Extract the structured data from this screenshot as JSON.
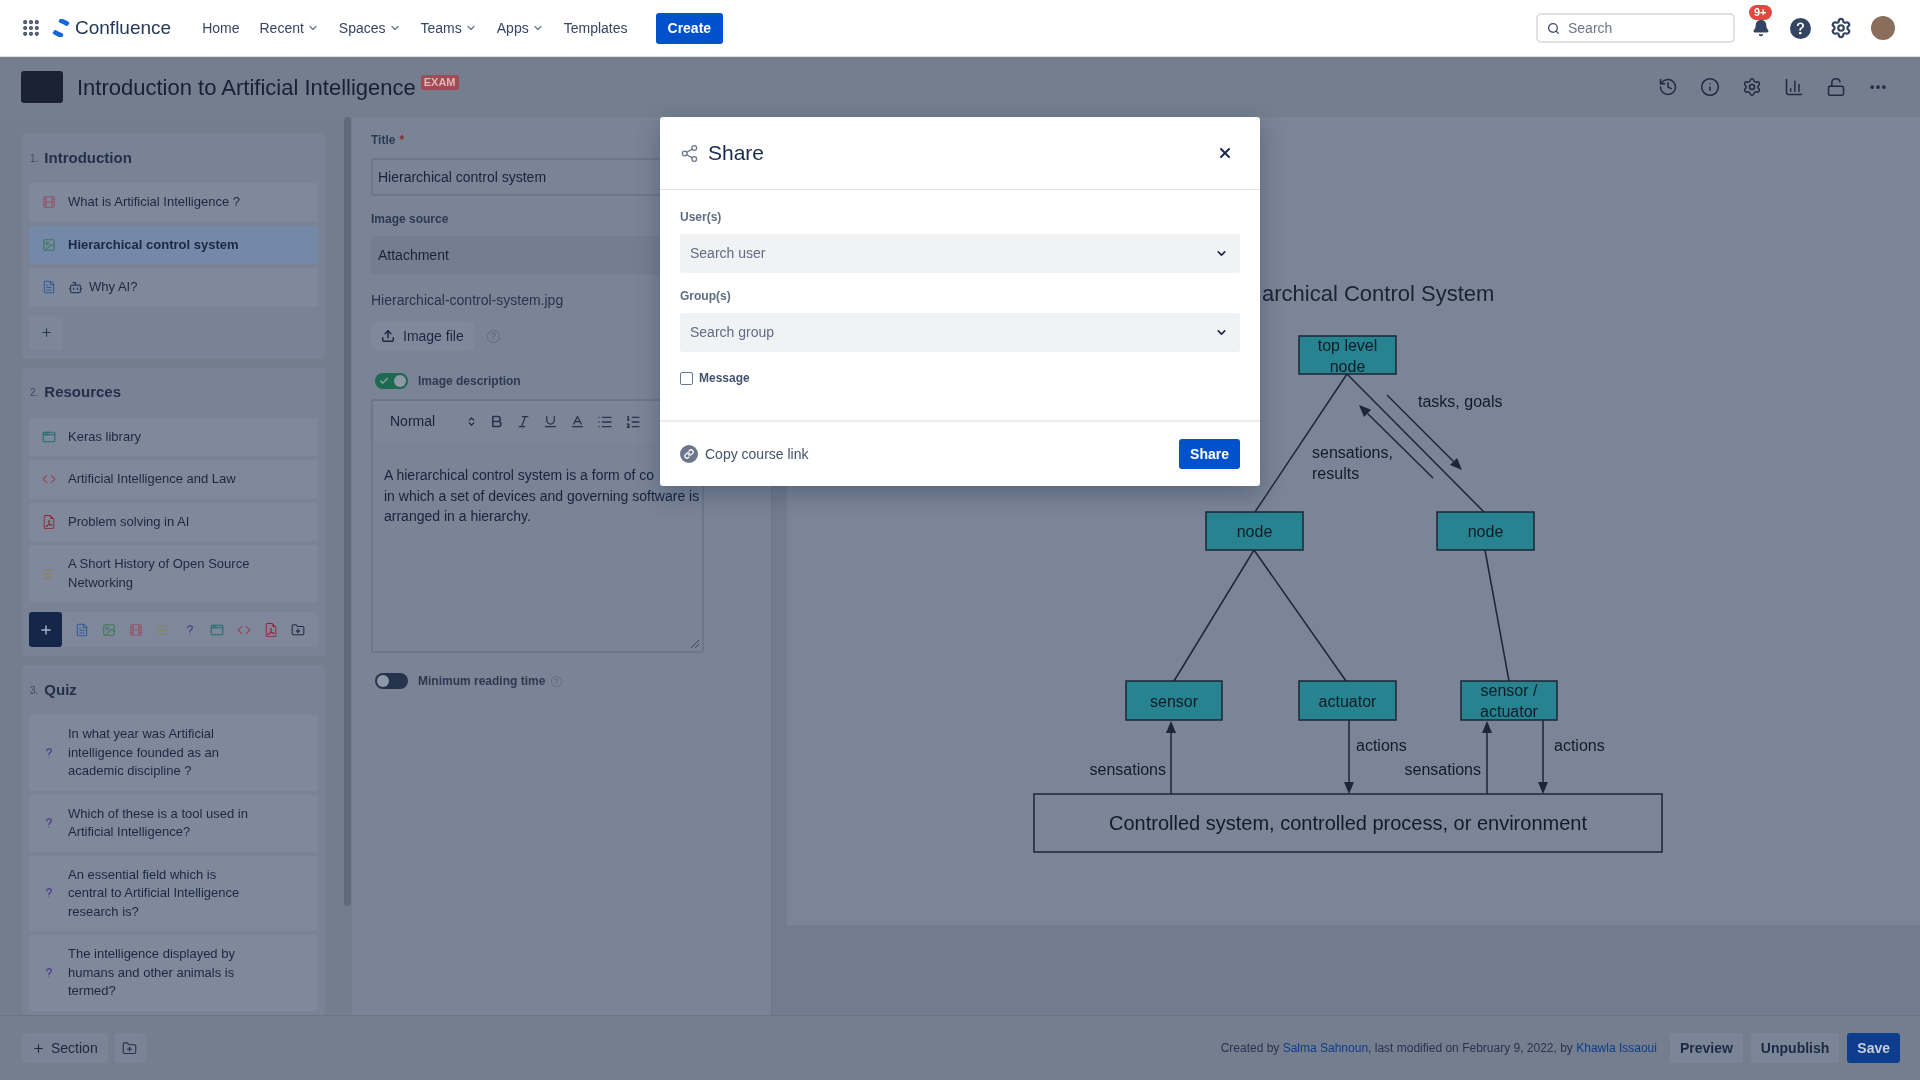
{
  "top_nav": {
    "product": "Confluence",
    "menu": [
      {
        "label": "Home",
        "dropdown": false
      },
      {
        "label": "Recent",
        "dropdown": true
      },
      {
        "label": "Spaces",
        "dropdown": true
      },
      {
        "label": "Teams",
        "dropdown": true
      },
      {
        "label": "Apps",
        "dropdown": true
      },
      {
        "label": "Templates",
        "dropdown": false
      }
    ],
    "create_button": "Create",
    "search": {
      "placeholder": "Search"
    },
    "notification_badge": "9+"
  },
  "course_header": {
    "title": "Introduction to Artificial Intelligence",
    "badge": "EXAM"
  },
  "sidebar": {
    "sections": [
      {
        "number": "1.",
        "title": "Introduction",
        "items": [
          {
            "kind": "video",
            "label": "What is Artificial Intelligence ?",
            "emoji": false,
            "selected": false
          },
          {
            "kind": "image",
            "label": "Hierarchical control system",
            "emoji": false,
            "selected": true
          },
          {
            "kind": "page",
            "label": "Why AI?",
            "emoji": true,
            "selected": false
          }
        ],
        "add": {
          "expanded": false
        }
      },
      {
        "number": "2.",
        "title": "Resources",
        "items": [
          {
            "kind": "web",
            "label": "Keras library",
            "emoji": false,
            "selected": false
          },
          {
            "kind": "code",
            "label": "Artificial Intelligence and Law",
            "emoji": false,
            "selected": false
          },
          {
            "kind": "pdf",
            "label": "Problem solving in AI",
            "emoji": false,
            "selected": false
          },
          {
            "kind": "text",
            "label": "A Short History of Open Source Networking",
            "emoji": false,
            "selected": false
          }
        ],
        "add": {
          "expanded": true
        }
      },
      {
        "number": "3.",
        "title": "Quiz",
        "items": [
          {
            "kind": "quiz",
            "label": "In what year was Artificial intelligence founded as an academic discipline ?",
            "emoji": false,
            "selected": false
          },
          {
            "kind": "quiz",
            "label": "Which of these is a tool used in Artificial Intelligence?",
            "emoji": false,
            "selected": false
          },
          {
            "kind": "quiz",
            "label": "An essential field which is central to Artificial Intelligence research is?",
            "emoji": false,
            "selected": false
          },
          {
            "kind": "quiz",
            "label": "The intelligence displayed by humans and other animals is termed?",
            "emoji": false,
            "selected": false
          }
        ]
      }
    ]
  },
  "editor": {
    "title_field": {
      "label": "Title",
      "required_mark": "*",
      "value": "Hierarchical control system"
    },
    "image_source": {
      "label": "Image source",
      "value": "Attachment"
    },
    "file_name": "Hierarchical-control-system.jpg",
    "upload_button": "Image file",
    "description_toggle": {
      "label": "Image description",
      "on": true
    },
    "text_style": "Normal",
    "description": [
      "A hierarchical control system is a form of co",
      "in which a set of devices and governing software is",
      "arranged in a hierarchy."
    ],
    "reading_time_toggle": {
      "label": "Minimum reading time",
      "on": false
    }
  },
  "preview": {
    "diagram": {
      "title": "archical Control System",
      "nodes": [
        {
          "lines": [
            "top level",
            "node"
          ]
        },
        {
          "lines": [
            "node"
          ]
        },
        {
          "lines": [
            "node"
          ]
        },
        {
          "lines": [
            "sensor"
          ]
        },
        {
          "lines": [
            "actuator"
          ]
        },
        {
          "lines": [
            "sensor /",
            "actuator"
          ]
        }
      ],
      "flow_labels": [
        {
          "lines": [
            "tasks, goals"
          ]
        },
        {
          "lines": [
            "sensations,",
            "results"
          ]
        },
        {
          "lines": [
            "sensations"
          ]
        },
        {
          "lines": [
            "actions"
          ]
        },
        {
          "lines": [
            "sensations"
          ]
        },
        {
          "lines": [
            "actions"
          ]
        }
      ],
      "environment": "Controlled system, controlled process, or environment"
    }
  },
  "share_dialog": {
    "title": "Share",
    "fields": [
      {
        "label": "User(s)",
        "placeholder": "Search user"
      },
      {
        "label": "Group(s)",
        "placeholder": "Search group"
      }
    ],
    "message": {
      "label": "Message",
      "checked": false
    },
    "copy_link": "Copy course link",
    "share_button": "Share"
  },
  "footer": {
    "add_section": "Section",
    "meta": {
      "created_by": "Created by",
      "author": "Salma Sahnoun",
      "modified": ", last modified on February 9, 2022, by",
      "editor": "Khawla Issaoui"
    },
    "buttons": [
      {
        "label": "Preview",
        "kind": "secondary"
      },
      {
        "label": "Unpublish",
        "kind": "secondary"
      },
      {
        "label": "Save",
        "kind": "primary"
      }
    ]
  }
}
